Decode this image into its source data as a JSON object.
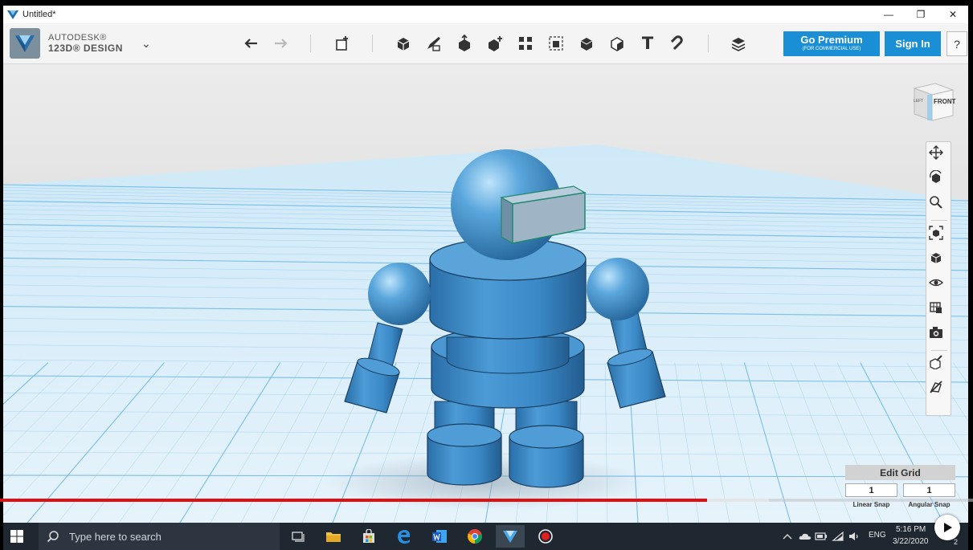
{
  "window": {
    "title": "Untitled*",
    "minimize_glyph": "—",
    "restore_glyph": "❐",
    "close_glyph": "✕"
  },
  "brand": {
    "line1": "AUTODESK®",
    "line2": "123D® DESIGN",
    "menu_caret": "⌄"
  },
  "toolbar": {
    "undo_icon": "undo-icon",
    "redo_icon": "redo-icon",
    "tools": [
      "transform",
      "primitives",
      "sketch",
      "construct",
      "modify",
      "pattern",
      "grouping",
      "combine",
      "measure",
      "text",
      "snap",
      "material"
    ],
    "text_tool_glyph": "T",
    "premium_label": "Go Premium",
    "premium_sublabel": "(FOR COMMERCIAL USE)",
    "signin_label": "Sign In",
    "help_label": "?"
  },
  "viewcube": {
    "front_label": "FRONT",
    "left_label": "LEFT"
  },
  "nav": {
    "items": [
      "pan",
      "orbit",
      "zoom",
      "fit",
      "views",
      "visibility",
      "materials",
      "screenshot",
      "snap",
      "hide-sketch"
    ]
  },
  "edit_grid": {
    "title": "Edit Grid",
    "linear_value": "1",
    "angular_value": "1",
    "linear_label": "Linear Snap",
    "angular_label": "Angular Snap"
  },
  "video": {
    "played_fraction": 0.727,
    "buffered_fraction": 0.79
  },
  "taskbar": {
    "search_placeholder": "Type here to search",
    "apps": [
      "task-view",
      "file-explorer",
      "store",
      "edge",
      "word",
      "chrome",
      "123d-design",
      "recorder"
    ],
    "language": "ENG",
    "time": "5:16 PM",
    "date": "3/22/2020",
    "notification_count": "2"
  },
  "colors": {
    "accent": "#1a8fd6",
    "model_blue": "#3a8fcf",
    "grid_line": "#6fb9e3",
    "progress_red": "#e01010"
  }
}
